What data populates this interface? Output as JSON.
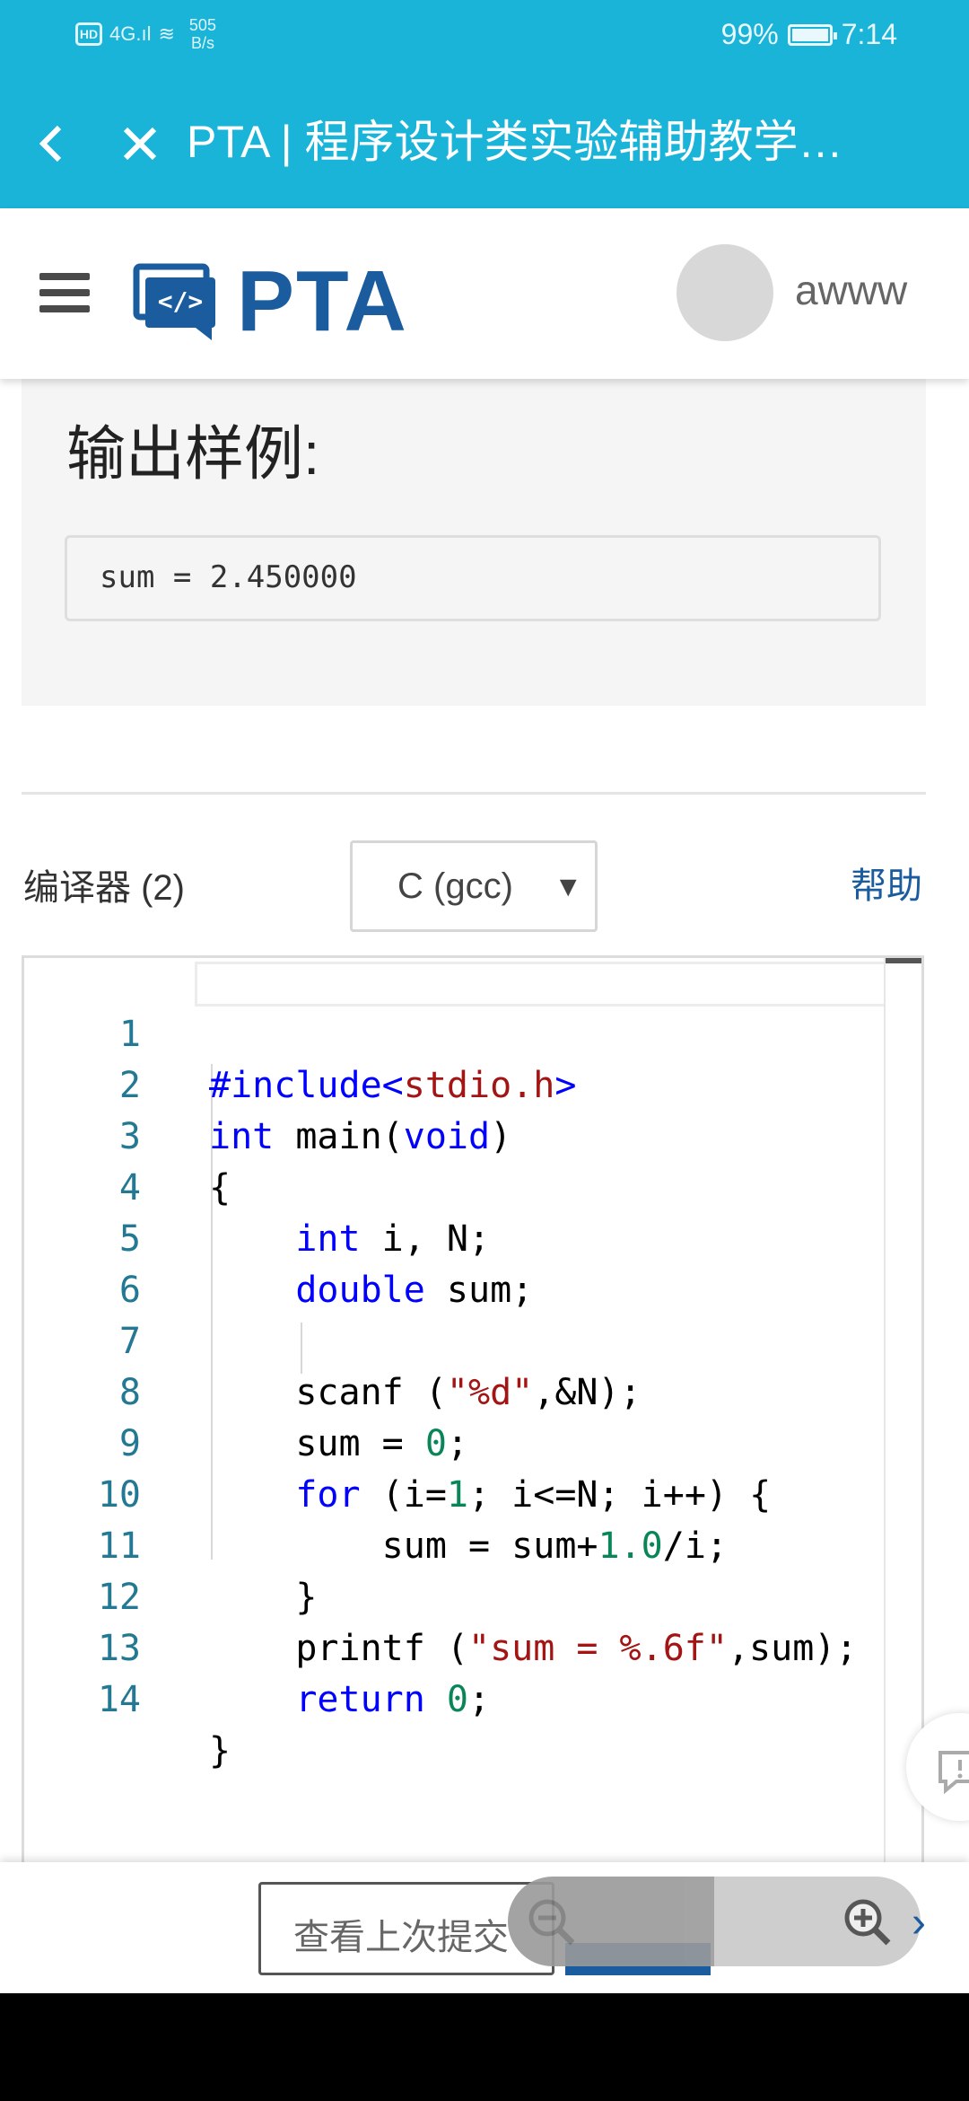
{
  "status_bar": {
    "network": "4G",
    "speed_value": "505",
    "speed_unit": "B/s",
    "battery": "99%",
    "time": "7:14"
  },
  "browser": {
    "title": "PTA | 程序设计类实验辅助教学…",
    "back_icon": "chevron-left-icon",
    "close_icon": "close-icon"
  },
  "header": {
    "logo_text": "PTA",
    "username": "awww"
  },
  "sample": {
    "heading": "输出样例:",
    "output": "sum = 2.450000"
  },
  "compiler": {
    "label": "编译器 (2)",
    "selected": "C (gcc)",
    "help": "帮助"
  },
  "editor": {
    "line_numbers": [
      "1",
      "2",
      "3",
      "4",
      "5",
      "6",
      "7",
      "8",
      "9",
      "10",
      "11",
      "12",
      "13",
      "14"
    ]
  },
  "bottom": {
    "last_submit": "查看上次提交"
  },
  "colors": {
    "accent": "#1bb4d9",
    "brand": "#1a5c9e"
  }
}
